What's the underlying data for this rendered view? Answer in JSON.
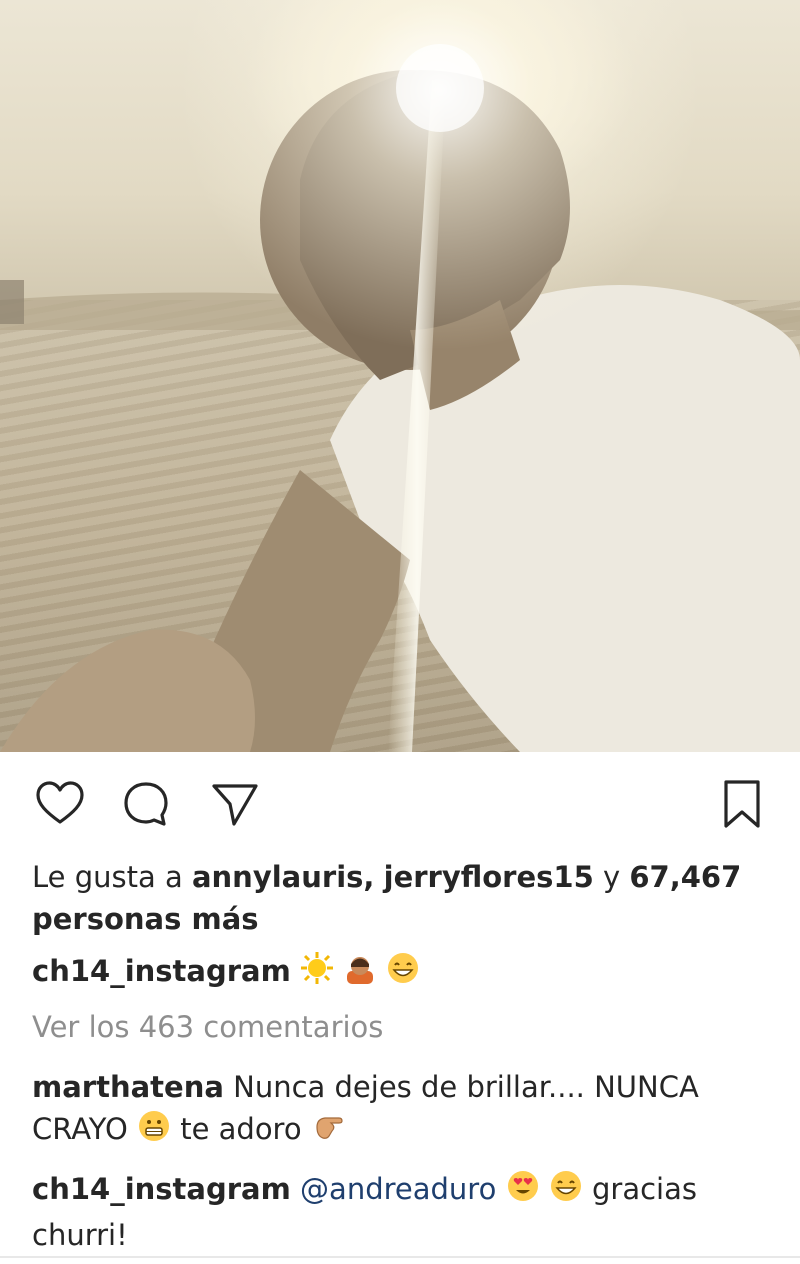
{
  "post": {
    "author": "ch14_instagram",
    "caption_emojis": [
      "sun",
      "person-bowing",
      "grinning-face"
    ],
    "likes": {
      "prefix": "Le gusta a",
      "user1": "annylauris,",
      "user2": "jerryflores15",
      "connector": "y",
      "count": "67,467",
      "suffix": "personas más"
    },
    "view_comments": "Ver los 463 comentarios"
  },
  "comments": [
    {
      "user": "marthatena",
      "text1": "Nunca dejes de brillar.... NUNCA",
      "text2": "CRAYO",
      "text3": "te adoro",
      "emojis": [
        "grimacing-face",
        "pointing-hand"
      ]
    },
    {
      "user": "ch14_instagram",
      "mention": "@andreaduro",
      "text": "gracias",
      "text2": "churri!",
      "emojis": [
        "heart-eyes-face",
        "grinning-face"
      ]
    }
  ],
  "icons": {
    "like": "heart-icon",
    "comment": "comment-icon",
    "share": "paper-plane-icon",
    "save": "bookmark-icon"
  },
  "colors": {
    "text": "#262626",
    "muted": "#8e8e8e",
    "mention": "#1f3f6e"
  }
}
